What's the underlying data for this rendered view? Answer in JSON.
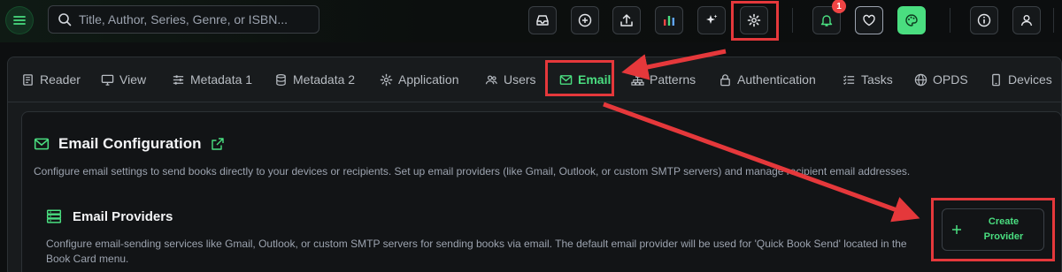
{
  "search": {
    "placeholder": "Title, Author, Series, Genre, or ISBN..."
  },
  "topbar": {
    "notification_count": "1",
    "accent": "#4ade80",
    "icons": [
      "inbox-icon",
      "plus-circle-icon",
      "upload-icon",
      "stats-icon",
      "sparkles-icon",
      "gear-icon",
      "bell-icon",
      "heart-icon",
      "palette-icon",
      "info-icon",
      "user-icon",
      "menu-icon"
    ]
  },
  "tabs": [
    {
      "label": "Reader",
      "icon": "book-icon"
    },
    {
      "label": "View",
      "icon": "monitor-icon"
    },
    {
      "label": "Metadata 1",
      "icon": "sliders-icon"
    },
    {
      "label": "Metadata 2",
      "icon": "database-icon"
    },
    {
      "label": "Application",
      "icon": "gear-icon"
    },
    {
      "label": "Users",
      "icon": "users-icon"
    },
    {
      "label": "Email",
      "icon": "envelope-icon",
      "active": true
    },
    {
      "label": "Patterns",
      "icon": "sitemap-icon"
    },
    {
      "label": "Authentication",
      "icon": "lock-icon"
    },
    {
      "label": "Tasks",
      "icon": "list-icon"
    },
    {
      "label": "OPDS",
      "icon": "globe-icon"
    },
    {
      "label": "Devices",
      "icon": "phone-icon"
    }
  ],
  "section": {
    "title": "Email Configuration",
    "description": "Configure email settings to send books directly to your devices or recipients. Set up email providers (like Gmail, Outlook, or custom SMTP servers) and manage recipient email addresses."
  },
  "providers": {
    "title": "Email Providers",
    "description": "Configure email-sending services like Gmail, Outlook, or custom SMTP servers for sending books via email. The default email provider will be used for 'Quick Book Send' located in the Book Card menu.",
    "create_label_line1": "Create",
    "create_label_line2": "Provider"
  },
  "colors": {
    "highlight": "#e5383b",
    "accent": "#4ade80"
  }
}
